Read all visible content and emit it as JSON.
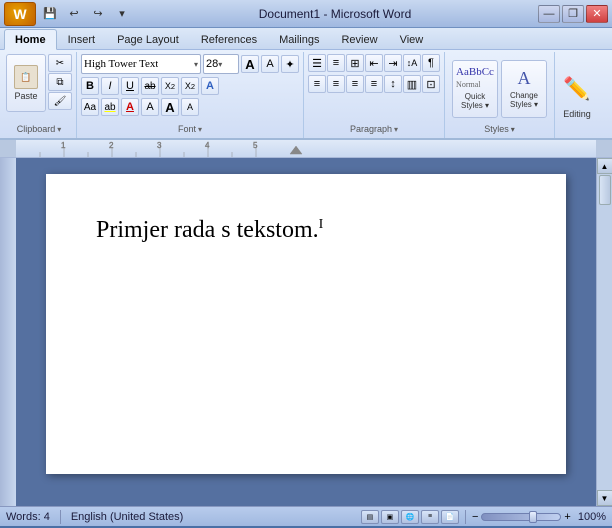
{
  "title": "Document1 - Microsoft Word",
  "controls": {
    "minimize": "—",
    "restore": "❐",
    "close": "✕"
  },
  "toolbar": {
    "save_label": "💾",
    "undo_label": "↩",
    "redo_label": "↪",
    "customize_label": "▾"
  },
  "tabs": [
    {
      "label": "Home",
      "active": true
    },
    {
      "label": "Insert",
      "active": false
    },
    {
      "label": "Page Layout",
      "active": false
    },
    {
      "label": "References",
      "active": false
    },
    {
      "label": "Mailings",
      "active": false
    },
    {
      "label": "Review",
      "active": false
    },
    {
      "label": "View",
      "active": false
    }
  ],
  "ribbon": {
    "clipboard": {
      "label": "Clipboard",
      "paste": "Paste",
      "cut": "✂",
      "copy": "⧉",
      "format_painter": "🖌"
    },
    "font": {
      "label": "Font",
      "font_name": "High Tower Text",
      "font_size": "28",
      "bold": "B",
      "italic": "I",
      "underline": "U",
      "strikethrough": "ab",
      "subscript": "X₂",
      "superscript": "X²",
      "clear_format": "A",
      "text_effects": "A",
      "text_highlight": "ab",
      "font_color": "A",
      "increase_size": "A",
      "decrease_size": "A",
      "change_case": "Aa",
      "font_color2": "A",
      "grow_font": "A↑",
      "shrink_font": "A↓"
    },
    "paragraph": {
      "label": "Paragraph",
      "bullets": "≡",
      "numbering": "1≡",
      "multilevel": "⊞≡",
      "decrease_indent": "⇤",
      "increase_indent": "⇥",
      "sort": "↕A",
      "show_hide": "¶",
      "align_left": "≡",
      "center": "≡",
      "align_right": "≡",
      "justify": "≡",
      "line_spacing": "↕",
      "shading": "▥",
      "border": "⊞"
    },
    "styles": {
      "label": "Styles",
      "quick_styles": "Quick\nStyles",
      "change_styles": "Change\nStyles",
      "arrow": "▾"
    },
    "editing": {
      "label": "Editing",
      "icon": "✏"
    }
  },
  "document": {
    "text": "Primjer rada s tekstom.",
    "cursor_visible": true
  },
  "status": {
    "words": "Words: 4",
    "language": "English (United States)",
    "zoom": "100%"
  }
}
